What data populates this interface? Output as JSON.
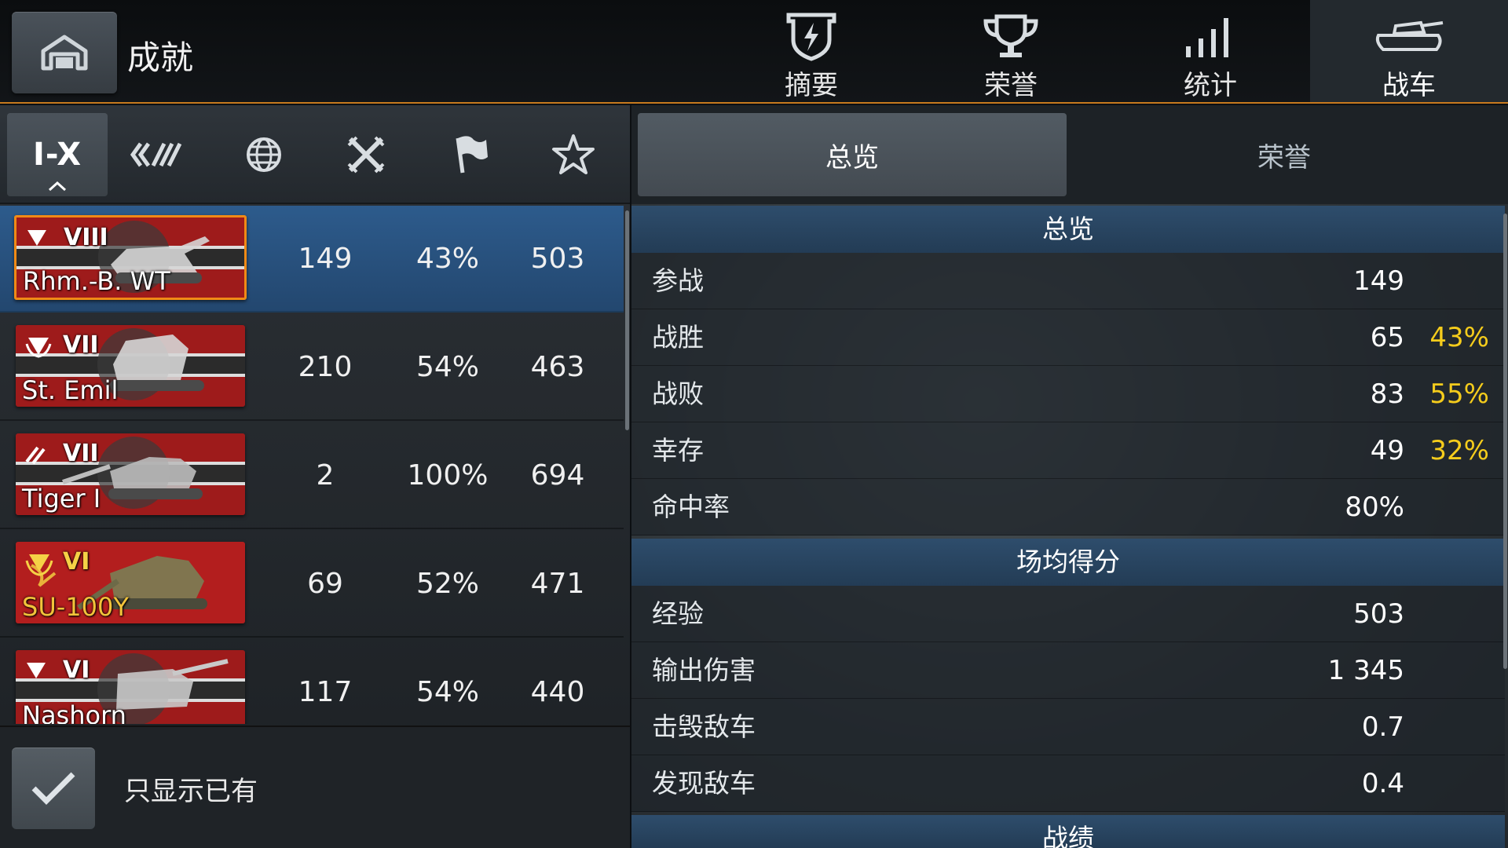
{
  "header": {
    "title": "成就",
    "tabs": [
      {
        "label": "摘要",
        "icon": "shield-icon"
      },
      {
        "label": "荣誉",
        "icon": "trophy-icon"
      },
      {
        "label": "统计",
        "icon": "bars-icon"
      },
      {
        "label": "战车",
        "icon": "tank-icon",
        "active": true
      }
    ]
  },
  "filters": {
    "tier_label": "I-X",
    "items": [
      "tier-filter",
      "class-filter",
      "nation-filter",
      "type-filter",
      "flag-filter",
      "premium-filter"
    ]
  },
  "tanks": [
    {
      "tier": "VIII",
      "name": "Rhm.-B. WT",
      "battles": "149",
      "winrate": "43%",
      "avg": "503",
      "selected": true
    },
    {
      "tier": "VII",
      "name": "St. Emil",
      "battles": "210",
      "winrate": "54%",
      "avg": "463"
    },
    {
      "tier": "VII",
      "name": "Tiger I",
      "battles": "2",
      "winrate": "100%",
      "avg": "694"
    },
    {
      "tier": "VI",
      "name": "SU-100Y",
      "battles": "69",
      "winrate": "52%",
      "avg": "471",
      "premium": true
    },
    {
      "tier": "VI",
      "name": "Nashorn",
      "battles": "117",
      "winrate": "54%",
      "avg": "440"
    }
  ],
  "owned_filter": {
    "label": "只显示已有",
    "checked": true
  },
  "subtabs": {
    "overview": "总览",
    "honors": "荣誉"
  },
  "overview": {
    "title": "总览",
    "rows": [
      {
        "label": "参战",
        "value": "149",
        "pct": ""
      },
      {
        "label": "战胜",
        "value": "65",
        "pct": "43%"
      },
      {
        "label": "战败",
        "value": "83",
        "pct": "55%"
      },
      {
        "label": "幸存",
        "value": "49",
        "pct": "32%"
      },
      {
        "label": "命中率",
        "value": "80%",
        "pct": ""
      }
    ]
  },
  "averages": {
    "title": "场均得分",
    "rows": [
      {
        "label": "经验",
        "value": "503"
      },
      {
        "label": "输出伤害",
        "value": "1 345"
      },
      {
        "label": "击毁敌车",
        "value": "0.7"
      },
      {
        "label": "发现敌车",
        "value": "0.4"
      }
    ]
  },
  "records": {
    "title": "战绩"
  },
  "colors": {
    "accent": "#f08a16",
    "selected_row": "#2d5b8c",
    "percent": "#f5cc1c",
    "premium": "#f2c33a"
  }
}
